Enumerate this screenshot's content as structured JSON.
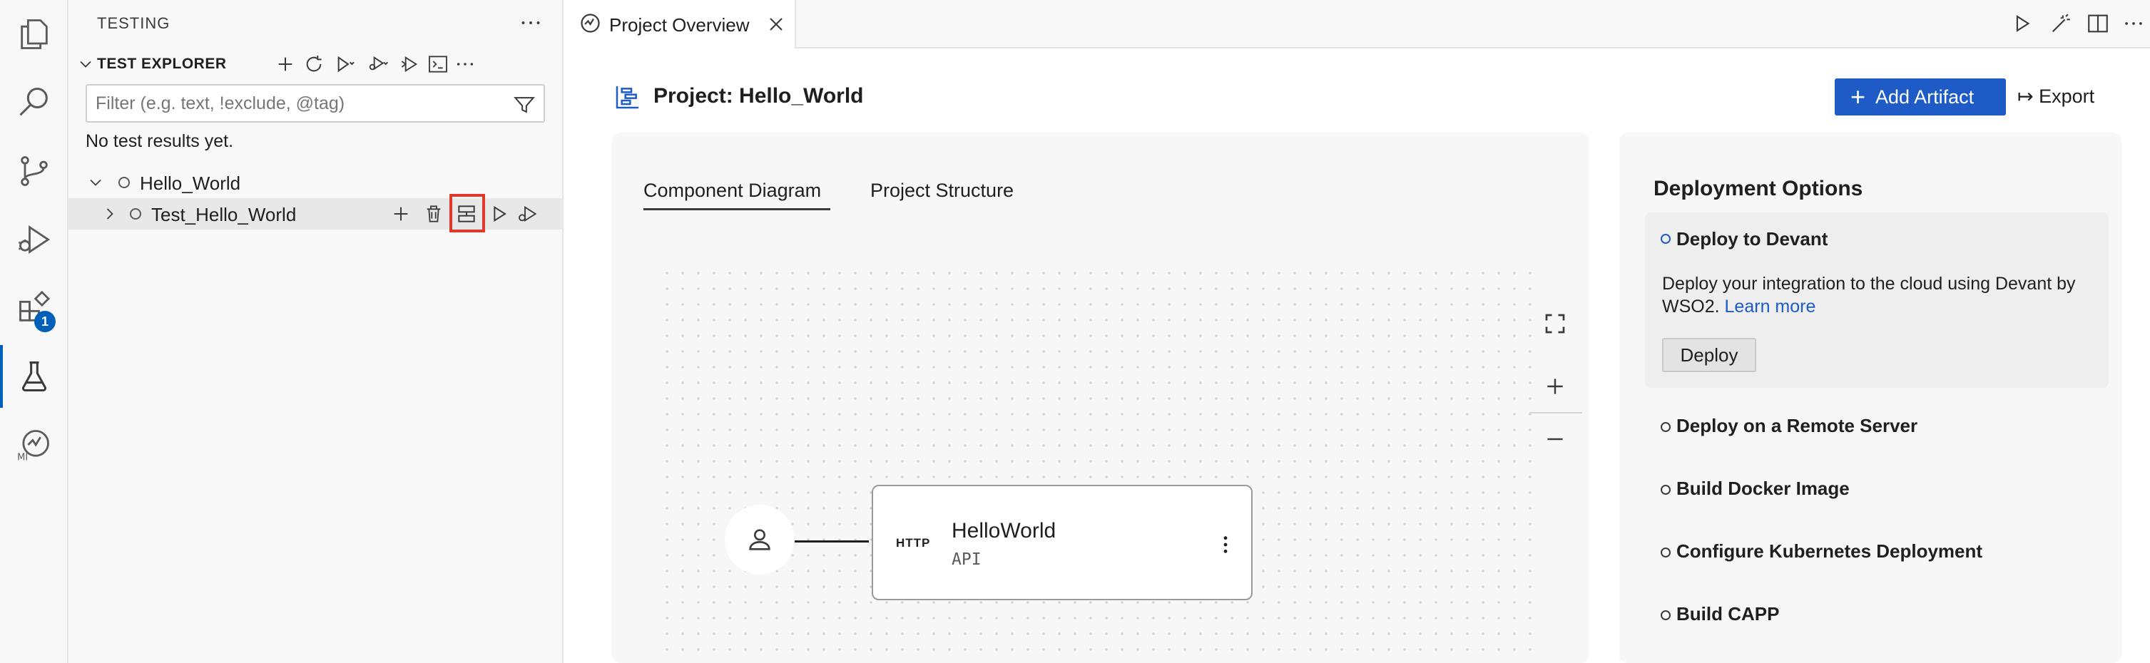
{
  "activity_bar": {
    "items": [
      {
        "name": "explorer-icon"
      },
      {
        "name": "search-icon"
      },
      {
        "name": "source-control-icon"
      },
      {
        "name": "run-debug-icon"
      },
      {
        "name": "extensions-icon",
        "badge": "1"
      },
      {
        "name": "testing-icon",
        "active": true
      },
      {
        "name": "micro-integrator-icon"
      }
    ]
  },
  "sidebar": {
    "title": "TESTING",
    "explorer_title": "TEST EXPLORER",
    "filter_placeholder": "Filter (e.g. text, !exclude, @tag)",
    "no_results": "No test results yet.",
    "tree": {
      "root": "Hello_World",
      "child": "Test_Hello_World"
    }
  },
  "editor": {
    "tab_label": "Project Overview",
    "project_title": "Project: Hello_World",
    "add_artifact_label": "Add Artifact",
    "export_label": "Export",
    "diagram": {
      "tabs": [
        "Component Diagram",
        "Project Structure"
      ],
      "active_tab": "Component Diagram",
      "api_node": {
        "protocol": "HTTP",
        "name": "HelloWorld",
        "type": "API"
      }
    },
    "deployment": {
      "title": "Deployment Options",
      "options": [
        "Deploy to Devant",
        "Deploy on a Remote Server",
        "Build Docker Image",
        "Configure Kubernetes Deployment",
        "Build CAPP"
      ],
      "active_description": "Deploy your integration to the cloud using Devant by WSO2.",
      "learn_more": "Learn more",
      "deploy_button": "Deploy"
    }
  },
  "colors": {
    "accent": "#1e5bc6",
    "highlight": "#e0392b"
  }
}
